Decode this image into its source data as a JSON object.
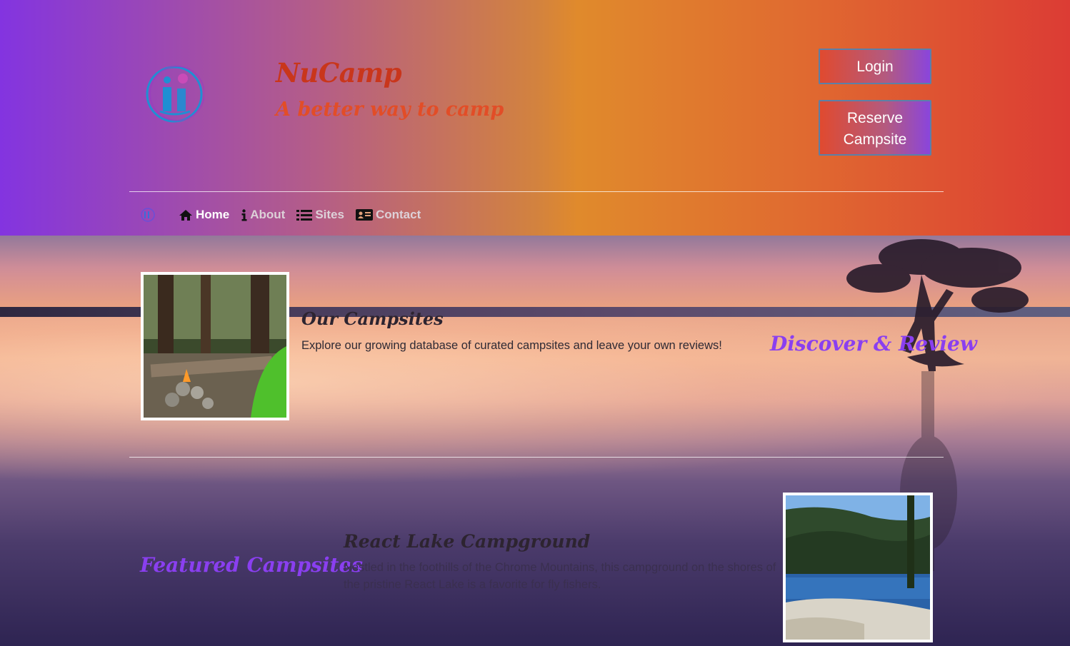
{
  "brand": {
    "title": "NuCamp",
    "tagline": "A better way to camp"
  },
  "header_buttons": {
    "login": "Login",
    "reserve": "Reserve Campsite"
  },
  "nav": {
    "items": [
      {
        "label": "Home",
        "icon": "home-icon",
        "active": true
      },
      {
        "label": "About",
        "icon": "info-icon",
        "active": false
      },
      {
        "label": "Sites",
        "icon": "list-icon",
        "active": false
      },
      {
        "label": "Contact",
        "icon": "address-card-icon",
        "active": false
      }
    ]
  },
  "sections": {
    "our_campsites": {
      "heading": "Our Campsites",
      "text": "Explore our growing database of curated campsites and leave your own reviews!",
      "accent": "Discover & Review"
    },
    "featured": {
      "accent": "Featured Campsites",
      "heading": "React Lake Campground",
      "text": "Nestled in the foothills of the Chrome Mountains, this campground on the shores of the pristine React Lake is a favorite for fly fishers."
    }
  },
  "colors": {
    "accent_purple": "#8a3ff0",
    "brand_red": "#c9361b",
    "tagline_orange": "#e24d27"
  }
}
